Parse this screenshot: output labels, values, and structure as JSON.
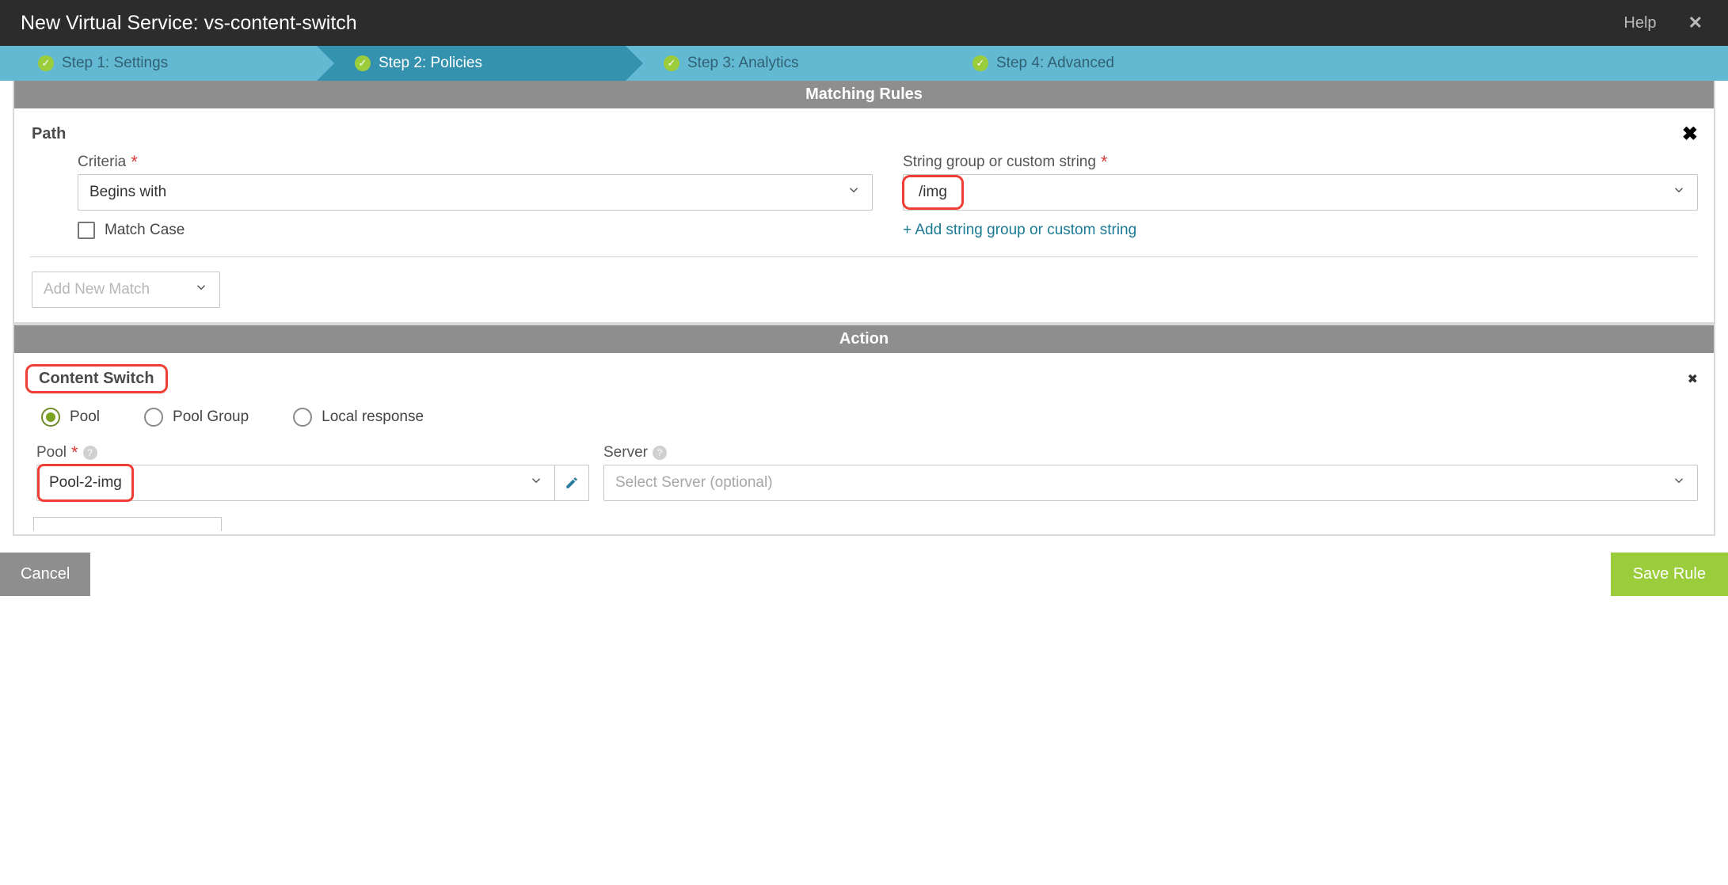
{
  "titlebar": {
    "title": "New Virtual Service: vs-content-switch",
    "help": "Help"
  },
  "steps": {
    "s1": "Step 1: Settings",
    "s2": "Step 2: Policies",
    "s3": "Step 3: Analytics",
    "s4": "Step 4: Advanced"
  },
  "matching": {
    "header": "Matching Rules",
    "path_label": "Path",
    "criteria_label": "Criteria",
    "criteria_value": "Begins with",
    "match_case": "Match Case",
    "string_label": "String group or custom string",
    "string_value": "/img",
    "add_string": "+ Add string group or custom string",
    "add_match_placeholder": "Add New Match"
  },
  "action": {
    "header": "Action",
    "cs_label": "Content Switch",
    "radios": {
      "pool": "Pool",
      "pool_group": "Pool Group",
      "local": "Local response"
    },
    "pool_label": "Pool",
    "pool_value": "Pool-2-img",
    "server_label": "Server",
    "server_placeholder": "Select Server (optional)"
  },
  "footer": {
    "cancel": "Cancel",
    "save": "Save Rule"
  }
}
